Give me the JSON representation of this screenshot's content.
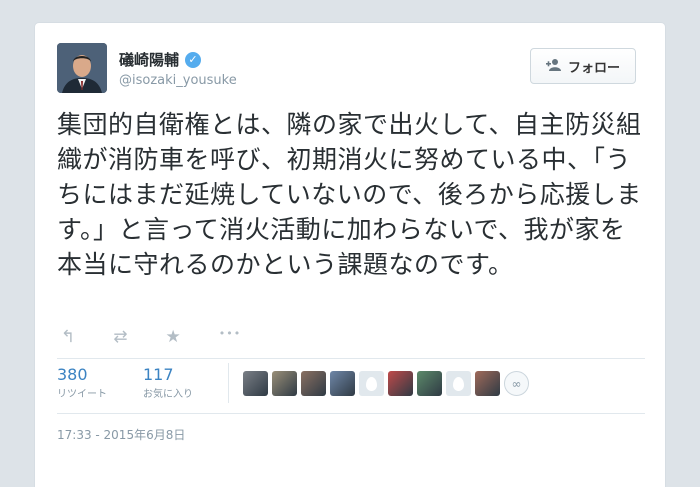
{
  "user": {
    "name": "礒崎陽輔",
    "handle": "@isozaki_yousuke",
    "verified_icon": "verified-badge-icon"
  },
  "follow_button": {
    "label": "フォロー",
    "icon": "add-user-icon"
  },
  "tweet": {
    "text": "集団的自衛権とは、隣の家で出火して、自主防災組織が消防車を呼び、初期消火に努めている中、「うちにはまだ延焼していないので、後ろから応援します。」と言って消火活動に加わらないで、我が家を本当に守れるのかという課題なのです。"
  },
  "actions": [
    {
      "name": "reply-icon",
      "glyph": "↰"
    },
    {
      "name": "retweet-icon",
      "glyph": "⇄"
    },
    {
      "name": "favorite-icon",
      "glyph": "★"
    },
    {
      "name": "more-icon",
      "glyph": "•••"
    }
  ],
  "stats": {
    "retweets": {
      "count": "380",
      "label": "リツイート"
    },
    "favorites": {
      "count": "117",
      "label": "お気に入り"
    }
  },
  "avatars": [
    {
      "kind": "photo",
      "color": "#7a7f86"
    },
    {
      "kind": "photo",
      "color": "#9a8f78"
    },
    {
      "kind": "photo",
      "color": "#8a7062"
    },
    {
      "kind": "photo",
      "color": "#6f87a8"
    },
    {
      "kind": "egg",
      "color": "#e1e8ed"
    },
    {
      "kind": "photo",
      "color": "#c04a4a"
    },
    {
      "kind": "photo",
      "color": "#5c8a6a"
    },
    {
      "kind": "egg",
      "color": "#e1e8ed"
    },
    {
      "kind": "photo",
      "color": "#a06a5a"
    }
  ],
  "more_avatars_icon": "more-avatars-icon",
  "timestamp": "17:33 - 2015年6月8日",
  "colors": {
    "link": "#3b83c2",
    "text": "#292f33",
    "muted": "#8899a6",
    "verified": "#55acee"
  }
}
